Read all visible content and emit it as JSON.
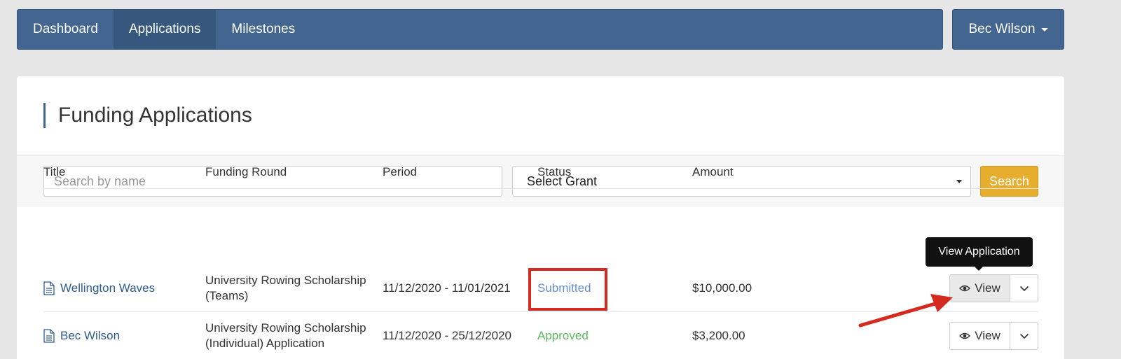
{
  "nav": {
    "items": [
      {
        "label": "Dashboard"
      },
      {
        "label": "Applications"
      },
      {
        "label": "Milestones"
      }
    ],
    "user": {
      "name": "Bec Wilson"
    }
  },
  "page": {
    "title": "Funding Applications"
  },
  "filters": {
    "search_placeholder": "Search by name",
    "grant_select_value": "Select Grant",
    "search_button": "Search"
  },
  "table": {
    "headers": [
      "Title",
      "Funding Round",
      "Period",
      "Status",
      "Amount"
    ],
    "rows": [
      {
        "title": "Wellington Waves",
        "round_line1": "University Rowing Scholarship",
        "round_line2": "(Teams)",
        "period": "11/12/2020 - 11/01/2021",
        "status": "Submitted",
        "amount": "$10,000.00",
        "view_label": "View"
      },
      {
        "title": "Bec Wilson",
        "round_line1": "University Rowing Scholarship",
        "round_line2": "(Individual) Application",
        "period": "11/12/2020 - 25/12/2020",
        "status": "Approved",
        "amount": "$3,200.00",
        "view_label": "View"
      }
    ]
  },
  "tooltip": {
    "text": "View Application"
  },
  "colors": {
    "nav_bg": "#42668f",
    "search_button": "#e6ad2e",
    "status_submitted": "#6a8fd1",
    "status_approved": "#5cb85c",
    "annotation_red": "#d42a1f"
  }
}
